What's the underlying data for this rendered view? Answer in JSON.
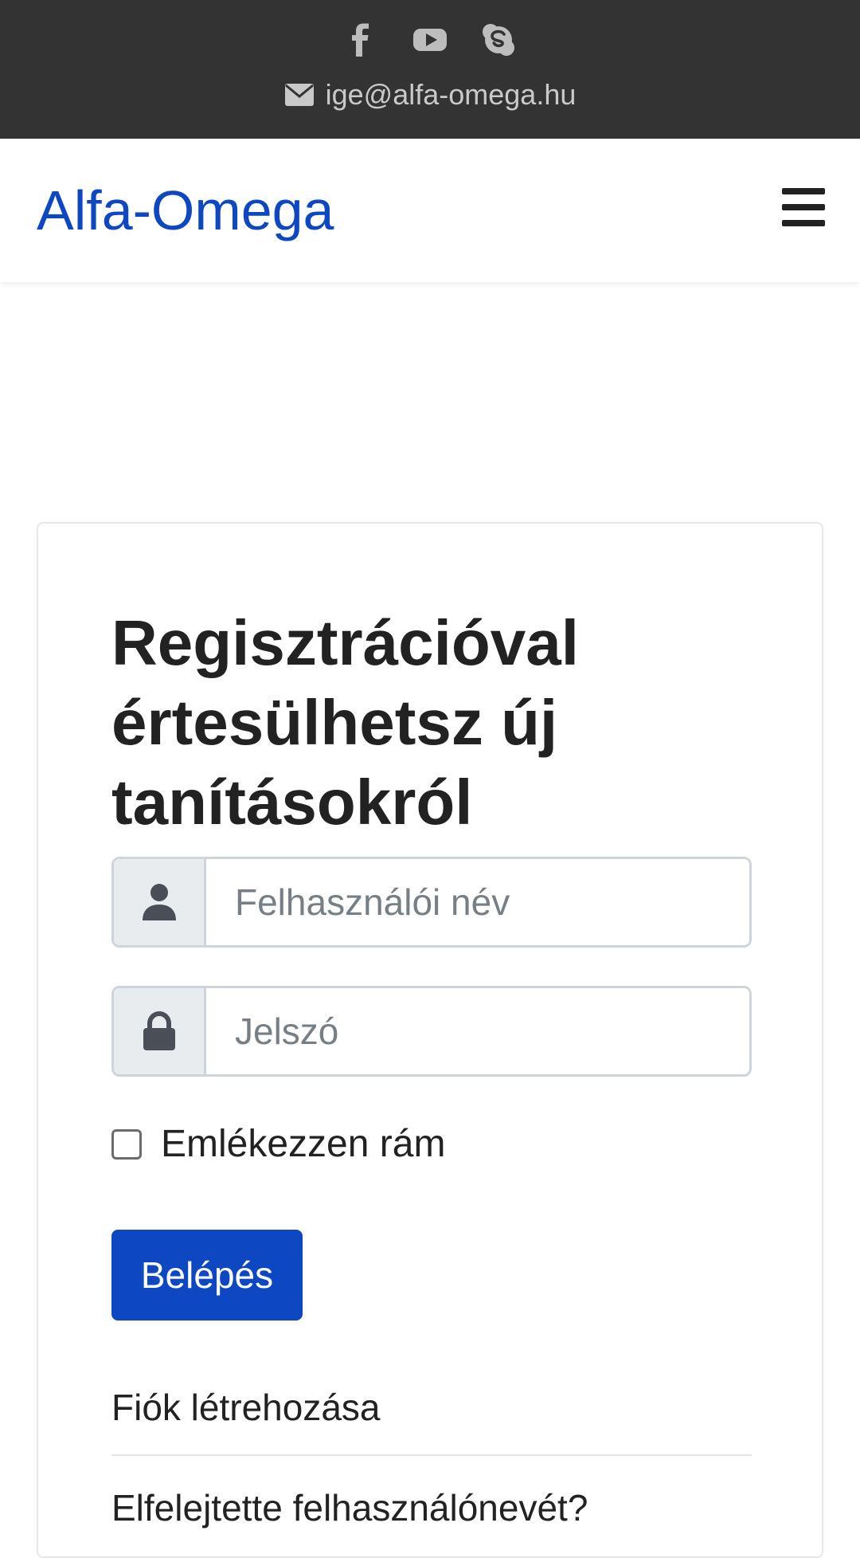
{
  "topbar": {
    "social_icons": [
      "facebook-icon",
      "youtube-icon",
      "skype-icon"
    ],
    "email_icon": "envelope-icon",
    "email": "ige@alfa-omega.hu",
    "background_color": "#333333"
  },
  "navbar": {
    "brand": "Alfa-Omega",
    "brand_color": "#0d47c1",
    "menu_icon": "hamburger-menu-icon"
  },
  "login_card": {
    "heading": "Regisztrációval értesülhetsz új tanításokról",
    "username": {
      "icon": "user-icon",
      "placeholder": "Felhasználói név",
      "value": ""
    },
    "password": {
      "icon": "lock-icon",
      "placeholder": "Jelszó",
      "value": ""
    },
    "remember_me": {
      "label": "Emlékezzen rám",
      "checked": false
    },
    "login_button": "Belépés",
    "button_color": "#0d47c1",
    "links": {
      "create_account": "Fiók létrehozása",
      "forgot_username": "Elfelejtette felhasználónevét?"
    }
  }
}
